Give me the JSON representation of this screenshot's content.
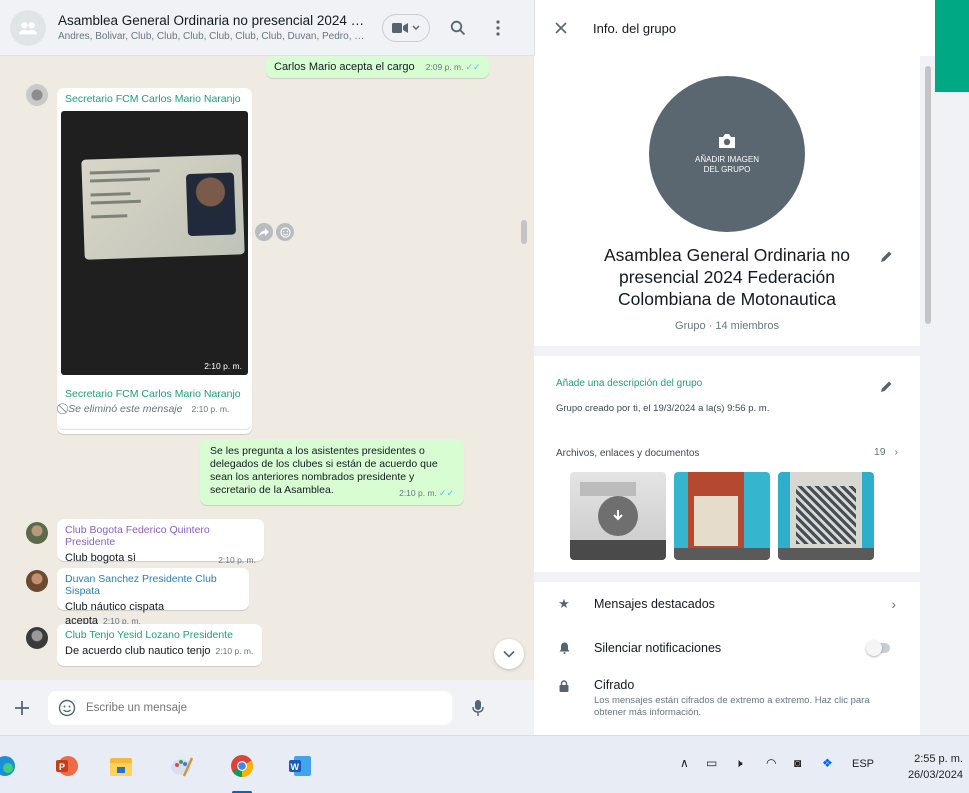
{
  "chat": {
    "header": {
      "title": "Asamblea General Ordinaria no presencial 2024 Feder...",
      "subtitle": "Andres, Bolivar, Club, Club, Club, Club, Club, Club, Duvan, Pedro, Re..."
    },
    "messages": [
      {
        "type": "out",
        "text": "Carlos Mario acepta el cargo",
        "time": "2:09 p. m."
      },
      {
        "type": "image",
        "sender": "Secretario FCM Carlos Mario Naranjo",
        "time": "2:10 p. m."
      },
      {
        "type": "deleted",
        "sender": "Secretario FCM Carlos Mario Naranjo",
        "text": "Se eliminó este mensaje",
        "time": "2:10 p. m."
      },
      {
        "type": "out",
        "text": "Se les pregunta a los asistentes presidentes o delegados de los clubes si están de acuerdo que sean los anteriores nombrados presidente y secretario de la Asamblea.",
        "time": "2:10 p. m."
      },
      {
        "type": "in",
        "sender": "Club Bogota Federico Quintero Presidente",
        "text": "Club bogota sì",
        "time": "2:10 p. m."
      },
      {
        "type": "in",
        "sender": "Duvan Sanchez Presidente Club Sispata",
        "text": "Club náutico cispata acepta",
        "time": "2:10 p. m."
      },
      {
        "type": "in",
        "sender": "Club Tenjo Yesid Lozano Presidente",
        "text": "De acuerdo club nautico tenjo",
        "time": "2:10 p. m."
      }
    ],
    "composer": {
      "placeholder": "Escribe un mensaje"
    }
  },
  "info": {
    "header_title": "Info. del grupo",
    "avatar_label": "AÑADIR IMAGEN DEL GRUPO",
    "group_name": "Asamblea General Ordinaria no presencial 2024 Federación Colombiana de Motonautica",
    "group_meta": "Grupo · 14 miembros",
    "add_description": "Añade una descripción del grupo",
    "created": "Grupo creado por ti, el 19/3/2024 a la(s) 9:56 p. m.",
    "files_label": "Archivos, enlaces y documentos",
    "files_count": "19",
    "starred": "Mensajes destacados",
    "mute": "Silenciar notificaciones",
    "encryption_title": "Cifrado",
    "encryption_desc": "Los mensajes están cifrados de extremo a extremo. Haz clic para obtener más información."
  },
  "taskbar": {
    "language": "ESP",
    "time": "2:55 p. m.",
    "date": "26/03/2024"
  },
  "colors": {
    "accent": "#00a884",
    "outgoing_bubble": "#d9fdd3",
    "chat_bg": "#efeae2"
  }
}
